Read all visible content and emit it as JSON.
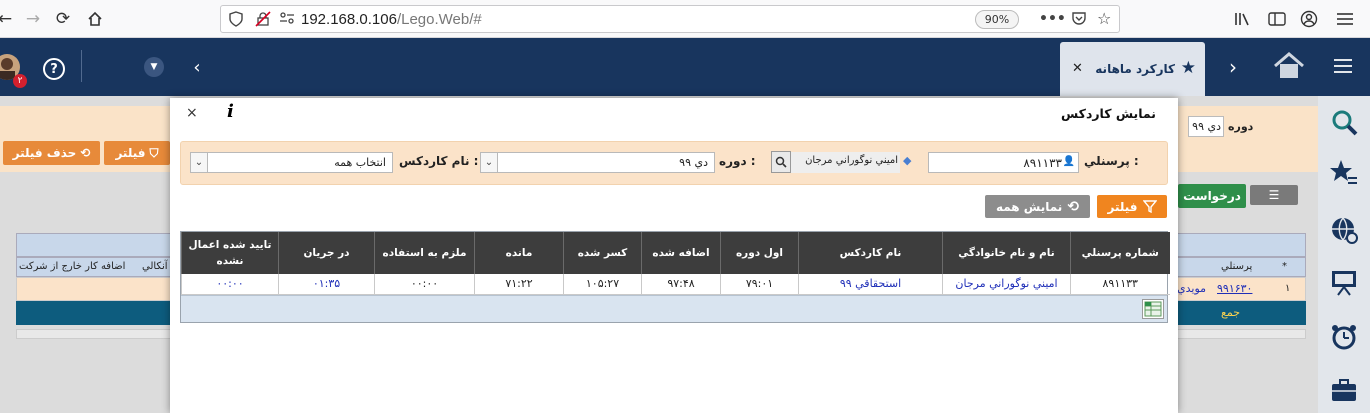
{
  "browser": {
    "url_host": "192.168.0.106",
    "url_path": "/Lego.Web/#",
    "zoom": "90%"
  },
  "app": {
    "active_tab": "کارکرد ماهانه",
    "notification_count": "۲"
  },
  "background": {
    "period_label": "دوره",
    "period_value": "دي ۹۹",
    "filter_button": "فيلتر",
    "remove_filter_button": "حذف فيلتر",
    "request_button": "درخواست",
    "columns": [
      "*",
      "پرسنلي",
      "",
      "کار آنکالي",
      "اضافه کار خارج از شرکت"
    ],
    "row": {
      "index": "۱",
      "personnel_no": "۹۹۱۶۳۰",
      "name": "مويدي"
    },
    "total_label": "جمع"
  },
  "modal": {
    "title": "نمايش کاردکس",
    "filters": {
      "personnel_label": "پرسنلي :",
      "personnel_value": "۸۹۱۱۳۳",
      "personnel_name": "اميني نوگوراني مرجان",
      "period_label": "دوره :",
      "period_value": "دي ۹۹",
      "kardex_label": "نام کاردکس :",
      "kardex_value": "انتخاب همه"
    },
    "buttons": {
      "filter": "فيلتر",
      "show_all": "نمايش همه"
    },
    "table": {
      "columns": [
        "شماره پرسنلي",
        "نام و نام خانوادگي",
        "نام کاردکس",
        "اول دوره",
        "اضافه شده",
        "کسر شده",
        "مانده",
        "ملزم به استفاده",
        "در جريان",
        "تاييد شده اعمال نشده"
      ],
      "rows": [
        [
          "۸۹۱۱۳۳",
          "اميني نوگوراني مرجان",
          "استحقاقي ۹۹",
          "۷۹:۰۱",
          "۹۷:۴۸",
          "۱۰۵:۲۷",
          "۷۱:۲۲",
          "۰۰:۰۰",
          "۰۱:۳۵",
          "۰۰:۰۰"
        ]
      ]
    }
  }
}
